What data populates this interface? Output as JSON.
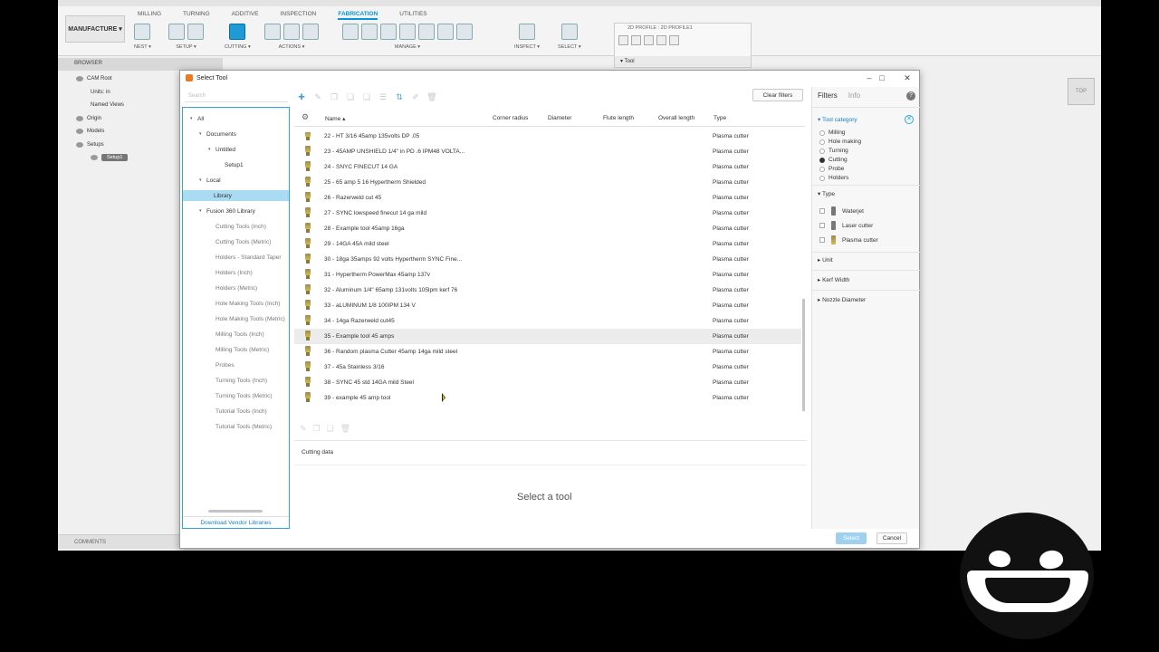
{
  "app": {
    "workspace_button": "MANUFACTURE ▾",
    "tabs": [
      "MILLING",
      "TURNING",
      "ADDITIVE",
      "INSPECTION",
      "FABRICATION",
      "UTILITIES"
    ],
    "active_tab": "FABRICATION",
    "groups": [
      "NEST ▾",
      "SETUP ▾",
      "CUTTING ▾",
      "ACTIONS ▾",
      "MANAGE ▾",
      "INSPECT ▾",
      "SELECT ▾"
    ],
    "browser_label": "BROWSER",
    "comments_label": "COMMENTS",
    "viewcube_label": "TOP",
    "profile_header": "2D PROFILE : 2D PROFILE1",
    "profile_tool": "▾ Tool"
  },
  "tree": {
    "cam_root": "CAM Root",
    "units": "Units: in",
    "named_views": "Named Views",
    "origin": "Origin",
    "models": "Models",
    "setups": "Setups",
    "setup1": "Setup1"
  },
  "dialog": {
    "title": "Select Tool",
    "search_placeholder": "Search",
    "clear_filters": "Clear filters",
    "left_tree": [
      {
        "label": "All",
        "indent": 1,
        "caret": "▾",
        "style": ""
      },
      {
        "label": "Documents",
        "indent": 2,
        "caret": "▾",
        "style": ""
      },
      {
        "label": "Untitled",
        "indent": 3,
        "caret": "▾",
        "style": ""
      },
      {
        "label": "Setup1",
        "indent": 4,
        "caret": "",
        "style": ""
      },
      {
        "label": "Local",
        "indent": 2,
        "caret": "▾",
        "style": ""
      },
      {
        "label": "Library",
        "indent": 3,
        "caret": "",
        "style": "sel"
      },
      {
        "label": "Fusion 360 Library",
        "indent": 2,
        "caret": "▾",
        "style": ""
      },
      {
        "label": "Cutting Tools (Inch)",
        "indent": 3,
        "caret": "",
        "style": "grey"
      },
      {
        "label": "Cutting Tools (Metric)",
        "indent": 3,
        "caret": "",
        "style": "grey"
      },
      {
        "label": "Holders - Standard Taper",
        "indent": 3,
        "caret": "",
        "style": "grey"
      },
      {
        "label": "Holders (Inch)",
        "indent": 3,
        "caret": "",
        "style": "grey"
      },
      {
        "label": "Holders (Metric)",
        "indent": 3,
        "caret": "",
        "style": "grey"
      },
      {
        "label": "Hole Making Tools (Inch)",
        "indent": 3,
        "caret": "",
        "style": "grey"
      },
      {
        "label": "Hole Making Tools (Metric)",
        "indent": 3,
        "caret": "",
        "style": "grey"
      },
      {
        "label": "Milling Tools (Inch)",
        "indent": 3,
        "caret": "",
        "style": "grey"
      },
      {
        "label": "Milling Tools (Metric)",
        "indent": 3,
        "caret": "",
        "style": "grey"
      },
      {
        "label": "Probes",
        "indent": 3,
        "caret": "",
        "style": "grey"
      },
      {
        "label": "Turning Tools (Inch)",
        "indent": 3,
        "caret": "",
        "style": "grey"
      },
      {
        "label": "Turning Tools (Metric)",
        "indent": 3,
        "caret": "",
        "style": "grey"
      },
      {
        "label": "Tutorial Tools (Inch)",
        "indent": 3,
        "caret": "",
        "style": "grey"
      },
      {
        "label": "Tutorial Tools (Metric)",
        "indent": 3,
        "caret": "",
        "style": "grey"
      }
    ],
    "download_link": "Download Vendor Libraries",
    "columns": {
      "name": "Name ▴",
      "corner_radius": "Corner radius",
      "diameter": "Diameter",
      "flute_length": "Flute length",
      "overall_length": "Overall length",
      "type": "Type"
    },
    "rows": [
      {
        "name": "22 - HT 3/16 45amp 135volts DP .05",
        "type": "Plasma cutter"
      },
      {
        "name": "23 - 45AMP UNSHIELD 1/4\" in PD .6 IPM48 VOLTA...",
        "type": "Plasma cutter"
      },
      {
        "name": "24 - SNYC FINECUT 14 GA",
        "type": "Plasma cutter"
      },
      {
        "name": "25 - 65 amp 5 16 Hypertherm Shielded",
        "type": "Plasma cutter"
      },
      {
        "name": "26 - Razerweld cut 45",
        "type": "Plasma cutter"
      },
      {
        "name": "27 - SYNC lowspeed finecut 14 ga mild",
        "type": "Plasma cutter"
      },
      {
        "name": "28 - Example tool 45amp 16ga",
        "type": "Plasma cutter"
      },
      {
        "name": "29 - 14GA 45A mild steel",
        "type": "Plasma cutter"
      },
      {
        "name": "30 - 18ga 35amps 92 volts Hypertherm SYNC Fine...",
        "type": "Plasma cutter"
      },
      {
        "name": "31 - Hypertherm PowerMax 45amp 137v",
        "type": "Plasma cutter"
      },
      {
        "name": "32 - Aluminum 1/4\" 65amp 131volts 105lpm kerf 76",
        "type": "Plasma cutter"
      },
      {
        "name": "33 - aLUMINUM 1/8 100IPM 134 V",
        "type": "Plasma cutter"
      },
      {
        "name": "34 - 14ga Razerweld cut45",
        "type": "Plasma cutter"
      },
      {
        "name": "35 - Example tool 45 amps",
        "type": "Plasma cutter"
      },
      {
        "name": "36 - Random plasma Cutter 45amp 14ga mild steel",
        "type": "Plasma cutter"
      },
      {
        "name": "37 - 45a Stainless 3/16",
        "type": "Plasma cutter"
      },
      {
        "name": "38 - SYNC 45 std 14GA mild Steel",
        "type": "Plasma cutter"
      },
      {
        "name": "39 - example 45 amp tool",
        "type": "Plasma cutter"
      }
    ],
    "hovered_row": 13,
    "cutting_data_label": "Cutting data",
    "select_prompt": "Select a tool",
    "select_button": "Select",
    "cancel_button": "Cancel",
    "filters": {
      "tab_filters": "Filters",
      "tab_info": "Info",
      "help": "?",
      "tool_category_label": "▾ Tool category",
      "categories": [
        {
          "label": "Milling",
          "selected": false
        },
        {
          "label": "Hole making",
          "selected": false
        },
        {
          "label": "Turning",
          "selected": false
        },
        {
          "label": "Cutting",
          "selected": true
        },
        {
          "label": "Probe",
          "selected": false
        },
        {
          "label": "Holders",
          "selected": false
        }
      ],
      "type_label": "▾ Type",
      "types": [
        "Waterjet",
        "Laser cutter",
        "Plasma cutter"
      ],
      "unit_label": "▸ Unit",
      "kerf_label": "▸ Kerf Width",
      "nozzle_label": "▸ Nozzle Diameter"
    }
  }
}
